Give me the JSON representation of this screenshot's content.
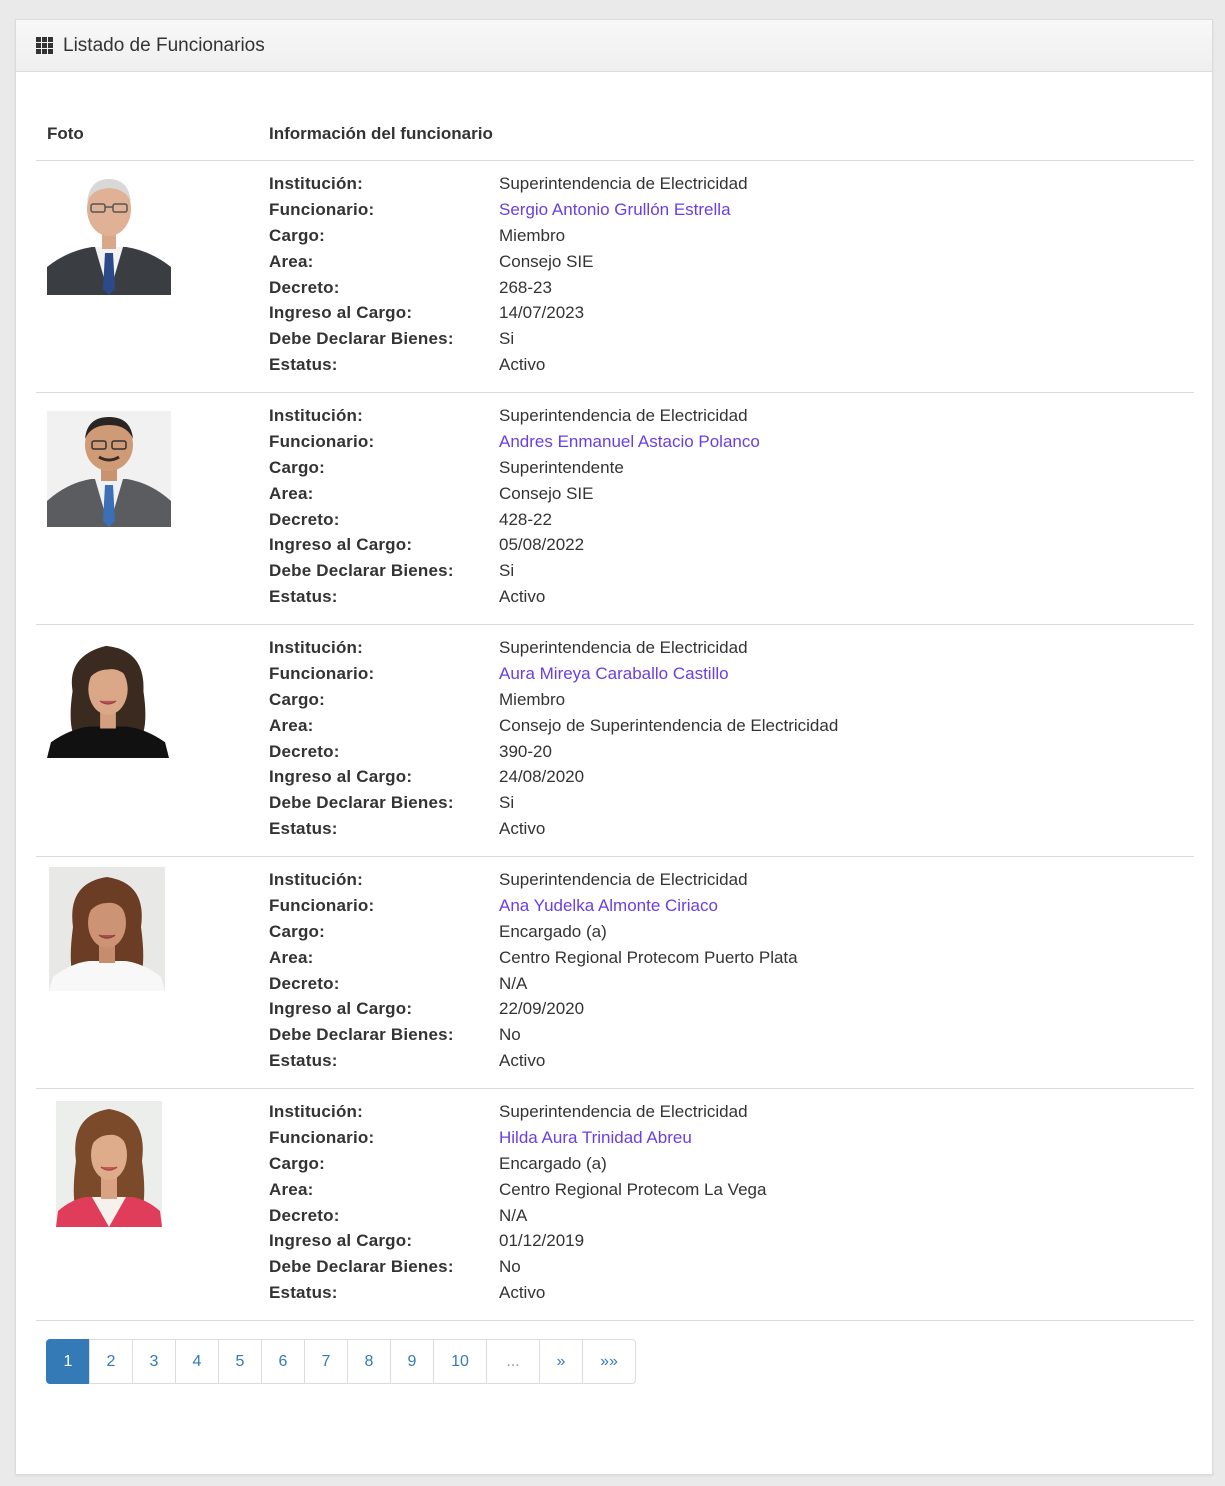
{
  "panel": {
    "title": "Listado de Funcionarios",
    "icon": "grid-icon"
  },
  "table": {
    "col_foto": "Foto",
    "col_info": "Información del funcionario"
  },
  "labels": {
    "institucion": "Institución:",
    "funcionario": "Funcionario:",
    "cargo": "Cargo:",
    "area": "Area:",
    "decreto": "Decreto:",
    "ingreso": "Ingreso al Cargo:",
    "declarar": "Debe Declarar Bienes:",
    "estatus": "Estatus:"
  },
  "officials": [
    {
      "institucion": "Superintendencia de Electricidad",
      "funcionario": "Sergio Antonio Grullón Estrella",
      "cargo": "Miembro",
      "area": "Consejo SIE",
      "decreto": "268-23",
      "ingreso": "14/07/2023",
      "declarar": "Si",
      "estatus": "Activo"
    },
    {
      "institucion": "Superintendencia de Electricidad",
      "funcionario": "Andres Enmanuel Astacio Polanco",
      "cargo": "Superintendente",
      "area": "Consejo SIE",
      "decreto": "428-22",
      "ingreso": "05/08/2022",
      "declarar": "Si",
      "estatus": "Activo"
    },
    {
      "institucion": "Superintendencia de Electricidad",
      "funcionario": "Aura Mireya Caraballo Castillo",
      "cargo": "Miembro",
      "area": "Consejo de Superintendencia de Electricidad",
      "decreto": "390-20",
      "ingreso": "24/08/2020",
      "declarar": "Si",
      "estatus": "Activo"
    },
    {
      "institucion": "Superintendencia de Electricidad",
      "funcionario": "Ana Yudelka Almonte Ciriaco",
      "cargo": "Encargado (a)",
      "area": "Centro Regional Protecom Puerto Plata",
      "decreto": "N/A",
      "ingreso": "22/09/2020",
      "declarar": "No",
      "estatus": "Activo"
    },
    {
      "institucion": "Superintendencia de Electricidad",
      "funcionario": "Hilda Aura Trinidad Abreu",
      "cargo": "Encargado (a)",
      "area": "Centro Regional Protecom La Vega",
      "decreto": "N/A",
      "ingreso": "01/12/2019",
      "declarar": "No",
      "estatus": "Activo"
    }
  ],
  "pagination": {
    "active": "1",
    "pages": [
      "1",
      "2",
      "3",
      "4",
      "5",
      "6",
      "7",
      "8",
      "9",
      "10"
    ],
    "ellipsis": "...",
    "next": "»",
    "last": "»»"
  },
  "colors": {
    "link": "#6a3fe0",
    "accent": "#337ab7"
  }
}
